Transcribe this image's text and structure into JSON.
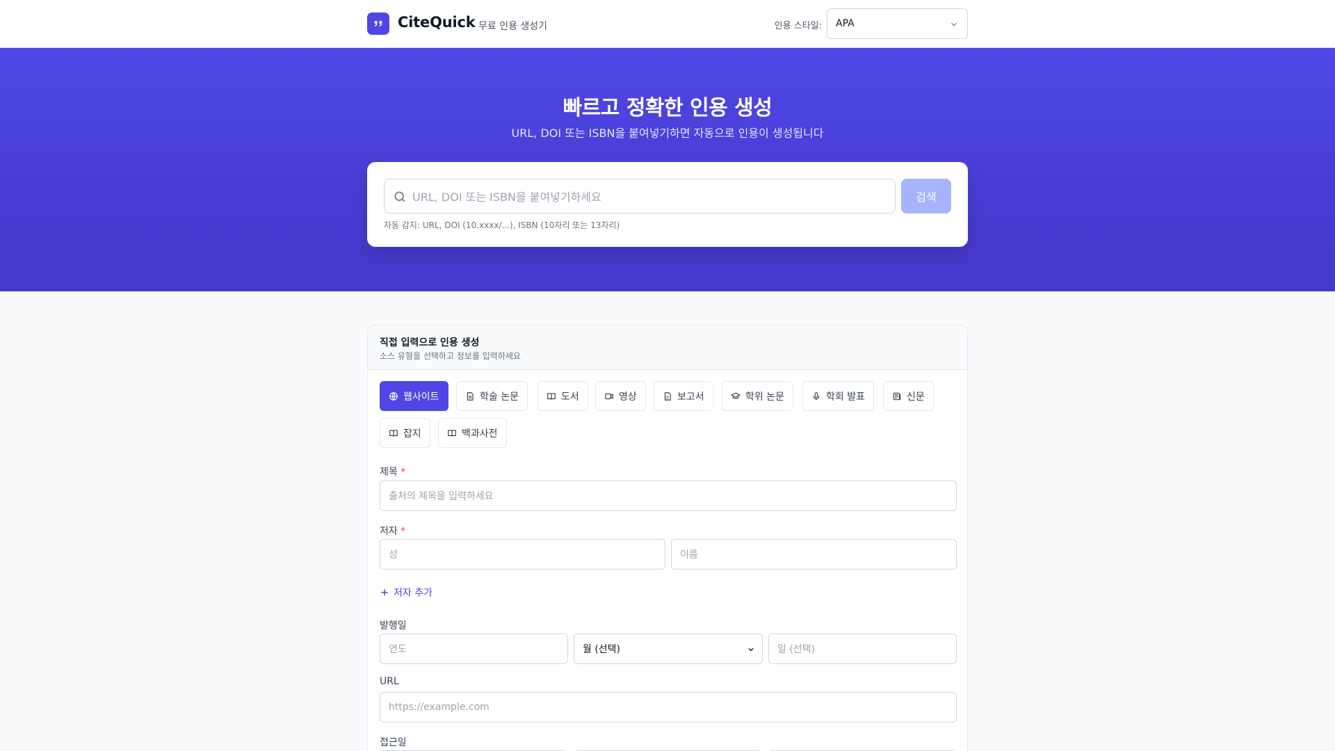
{
  "header": {
    "brand": "CiteQuick",
    "tagline": "무료 인용 생성기",
    "style_label": "인용 스타일:",
    "style_value": "APA"
  },
  "hero": {
    "title": "빠르고 정확한 인용 생성",
    "subtitle": "URL, DOI 또는 ISBN을 붙여넣기하면 자동으로 인용이 생성됩니다",
    "search_placeholder": "URL, DOI 또는 ISBN을 붙여넣기하세요",
    "search_button": "검색",
    "hint": "자동 감지: URL, DOI (10.xxxx/...), ISBN (10자리 또는 13자리)"
  },
  "manual": {
    "title": "직접 입력으로 인용 생성",
    "subtitle": "소스 유형을 선택하고 정보를 입력하세요",
    "source_types": [
      {
        "label": "웹사이트",
        "icon": "globe-icon",
        "active": true
      },
      {
        "label": "학술 논문",
        "icon": "document-icon",
        "active": false
      },
      {
        "label": "도서",
        "icon": "book-icon",
        "active": false
      },
      {
        "label": "영상",
        "icon": "video-icon",
        "active": false
      },
      {
        "label": "보고서",
        "icon": "report-icon",
        "active": false
      },
      {
        "label": "학위 논문",
        "icon": "graduation-cap-icon",
        "active": false
      },
      {
        "label": "학회 발표",
        "icon": "microphone-icon",
        "active": false
      },
      {
        "label": "신문",
        "icon": "newspaper-icon",
        "active": false
      },
      {
        "label": "잡지",
        "icon": "book-open-icon",
        "active": false
      },
      {
        "label": "백과사전",
        "icon": "book-open-icon",
        "active": false
      }
    ],
    "title_label": "제목",
    "title_placeholder": "출처의 제목을 입력하세요",
    "author_label": "저자",
    "last_name_placeholder": "성",
    "first_name_placeholder": "이름",
    "add_author": "저자 추가",
    "date_label": "발행일",
    "year_placeholder": "연도",
    "month_value": "월 (선택)",
    "day_placeholder": "일 (선택)",
    "url_label": "URL",
    "url_placeholder": "https://example.com",
    "access_label": "접근일",
    "required_mark": "*",
    "accent_color": "#4f46e5"
  }
}
